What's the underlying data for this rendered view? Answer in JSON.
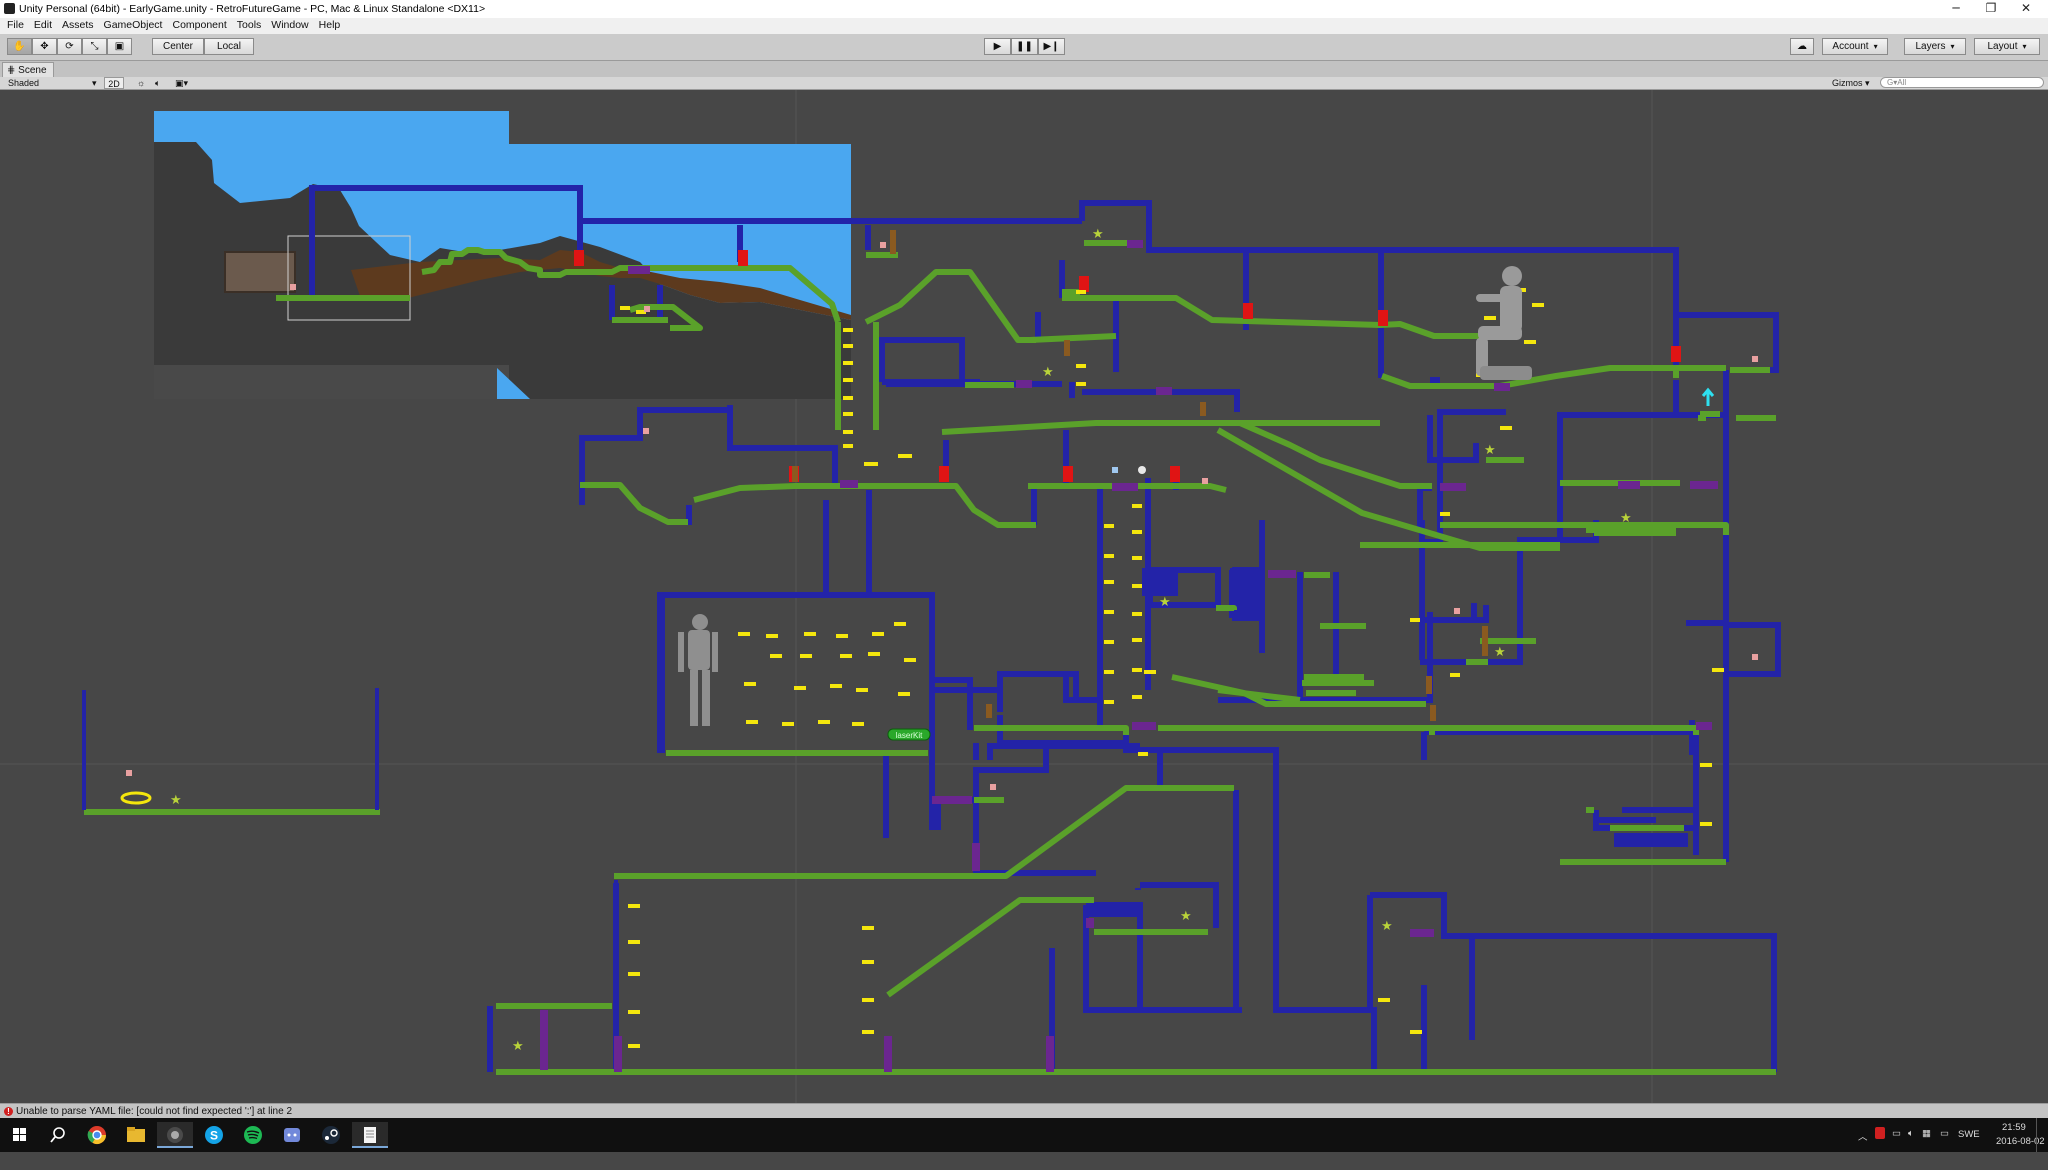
{
  "window": {
    "title": "Unity Personal (64bit) - EarlyGame.unity - RetroFutureGame - PC, Mac & Linux Standalone <DX11>",
    "controls": [
      "minimize-icon",
      "restore-icon",
      "close-icon"
    ]
  },
  "menu": [
    "File",
    "Edit",
    "Assets",
    "GameObject",
    "Component",
    "Tools",
    "Window",
    "Help"
  ],
  "toolbar": {
    "transform_tools": [
      "hand-icon",
      "move-icon",
      "rotate-icon",
      "scale-icon",
      "rect-icon"
    ],
    "pivot_mode": "Center",
    "pivot_rotation": "Local",
    "play_controls": [
      "play-icon",
      "pause-icon",
      "step-icon"
    ],
    "cloud_icon": "cloud-icon",
    "account": "Account",
    "layers": "Layers",
    "layout": "Layout"
  },
  "scene_tab": {
    "label": "Scene",
    "draw_mode": "Shaded",
    "mode_2d": "2D",
    "gizmos": "Gizmos",
    "search_placeholder": "G▾All"
  },
  "scene": {
    "label_laserkit": "laserKit"
  },
  "colors": {
    "platform_green": "#5aa12a",
    "wall_blue": "#2323a8",
    "door_red": "#e01414",
    "purple_block": "#6b2690",
    "sky": "#4aa7f0",
    "coin_yellow": "#f4e60d"
  },
  "statusbar": {
    "icon": "error-icon",
    "message": "Unable to parse YAML file: [could not find expected ':'] at line 2"
  },
  "taskbar": {
    "apps": [
      "windows-start-icon",
      "search-icon",
      "chrome-icon",
      "file-explorer-icon",
      "unity-icon",
      "skype-icon",
      "spotify-icon",
      "discord-icon",
      "steam-icon",
      "notepad-icon"
    ],
    "tray_language": "SWE",
    "time": "21:59",
    "date": "2016-08-02"
  }
}
